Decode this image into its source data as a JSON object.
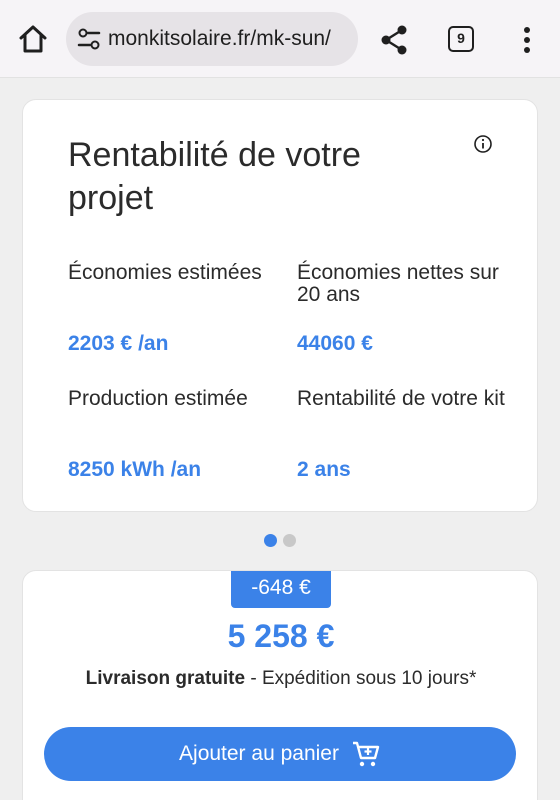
{
  "browser": {
    "url": "monkitsolaire.fr/mk-sun/",
    "tab_count": "9",
    "icons": [
      "home-icon",
      "site-settings-icon",
      "share-icon",
      "tabs-icon",
      "more-vert-icon"
    ]
  },
  "profitability": {
    "title": "Rentabilité de votre projet",
    "stats": [
      {
        "label": "Économies estimées",
        "value": "2203 € /an"
      },
      {
        "label": "Économies nettes sur 20 ans",
        "value": "44060 €"
      },
      {
        "label": "Production estimée",
        "value": "8250 kWh /an"
      },
      {
        "label": "Rentabilité de votre kit",
        "value": "2 ans"
      }
    ]
  },
  "carousel": {
    "active_index": 0,
    "count": 2
  },
  "offer": {
    "discount": "-648 €",
    "price": "5 258 €",
    "delivery_bold": "Livraison gratuite",
    "delivery_rest": " - Expédition sous 10 jours*",
    "cart_button": "Ajouter au panier"
  },
  "colors": {
    "accent": "#3b82e8",
    "background": "#efefef",
    "card": "#ffffff"
  }
}
